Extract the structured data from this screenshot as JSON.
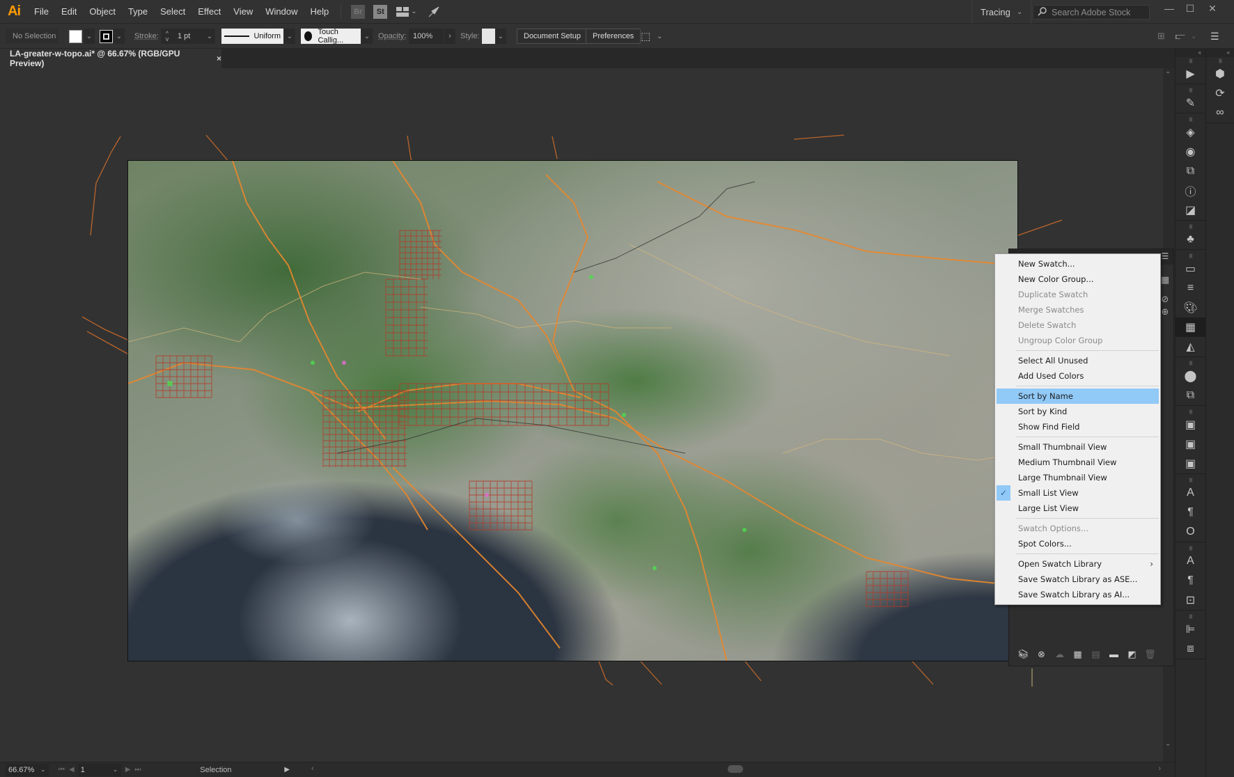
{
  "app": {
    "logo": "Ai",
    "menu": [
      "File",
      "Edit",
      "Object",
      "Type",
      "Select",
      "Effect",
      "View",
      "Window",
      "Help"
    ],
    "bridge_label": "Br",
    "stock_label": "St",
    "workspace": "Tracing",
    "search_placeholder": "Search Adobe Stock",
    "window_controls": {
      "minimize": "—",
      "maximize": "☐",
      "close": "✕"
    }
  },
  "control_bar": {
    "selection_label": "No Selection",
    "fill_color": "#ffffff",
    "stroke_label": "Stroke:",
    "stroke_weight": "1 pt",
    "profile_label": "Uniform",
    "brush_label": "Touch Callig...",
    "opacity_label": "Opacity:",
    "opacity_value": "100%",
    "style_label": "Style:",
    "document_setup_label": "Document Setup",
    "preferences_label": "Preferences"
  },
  "document": {
    "tab_title": "LA-greater-w-topo.ai* @ 66.67% (RGB/GPU Preview)",
    "tab_close": "×"
  },
  "context_menu": {
    "groups": [
      [
        {
          "label": "New Swatch...",
          "enabled": true
        },
        {
          "label": "New Color Group...",
          "enabled": true
        },
        {
          "label": "Duplicate Swatch",
          "enabled": false
        },
        {
          "label": "Merge Swatches",
          "enabled": false
        },
        {
          "label": "Delete Swatch",
          "enabled": false
        },
        {
          "label": "Ungroup Color Group",
          "enabled": false
        }
      ],
      [
        {
          "label": "Select All Unused",
          "enabled": true
        },
        {
          "label": "Add Used Colors",
          "enabled": true
        }
      ],
      [
        {
          "label": "Sort by Name",
          "enabled": true,
          "hovered": true
        },
        {
          "label": "Sort by Kind",
          "enabled": true
        },
        {
          "label": "Show Find Field",
          "enabled": true
        }
      ],
      [
        {
          "label": "Small Thumbnail View",
          "enabled": true
        },
        {
          "label": "Medium Thumbnail View",
          "enabled": true
        },
        {
          "label": "Large Thumbnail View",
          "enabled": true
        },
        {
          "label": "Small List View",
          "enabled": true,
          "checked": true
        },
        {
          "label": "Large List View",
          "enabled": true
        }
      ],
      [
        {
          "label": "Swatch Options...",
          "enabled": false
        },
        {
          "label": "Spot Colors...",
          "enabled": true
        }
      ],
      [
        {
          "label": "Open Swatch Library",
          "enabled": true,
          "submenu": true
        },
        {
          "label": "Save Swatch Library as ASE...",
          "enabled": true
        },
        {
          "label": "Save Swatch Library as AI...",
          "enabled": true
        }
      ]
    ],
    "hover_color": "#91c9f7"
  },
  "swatch_panel_footer": [
    "swatch-libraries-icon",
    "place-swatch-icon",
    "cc-library-icon",
    "swatch-kind-icon",
    "swatch-options-icon",
    "new-color-group-icon",
    "new-swatch-icon",
    "delete-swatch-icon"
  ],
  "dock1_groups": [
    [
      "actions-icon"
    ],
    [
      "brushes-icon"
    ],
    [
      "layers-icon",
      "appearance-icon",
      "transform-icon",
      "info-icon",
      "image-trace-icon"
    ],
    [
      "symbols-icon"
    ],
    [
      "gradient-icon",
      "stroke-icon",
      "color-guide-icon",
      "swatches-icon",
      "transparency-icon"
    ],
    [
      "pathfinder-icon",
      "artboards-icon"
    ],
    [
      "asset-export-icon",
      "links-icon",
      "libraries-icon"
    ],
    [
      "character-icon",
      "paragraph-icon",
      "opentype-icon"
    ],
    [
      "character-styles-icon",
      "paragraph-styles-icon",
      "document-info-icon"
    ],
    [
      "align-icon",
      "transform-panel-icon"
    ]
  ],
  "dock2_icons": [
    "properties-icon",
    "sync-icon",
    "creative-cloud-icon"
  ],
  "status_bar": {
    "zoom": "66.67%",
    "artboard_number": "1",
    "tool_status": "Selection"
  },
  "colors": {
    "accent": "#ff9a00",
    "road_major": "#e8872e",
    "road_minor": "#b33a2a"
  }
}
